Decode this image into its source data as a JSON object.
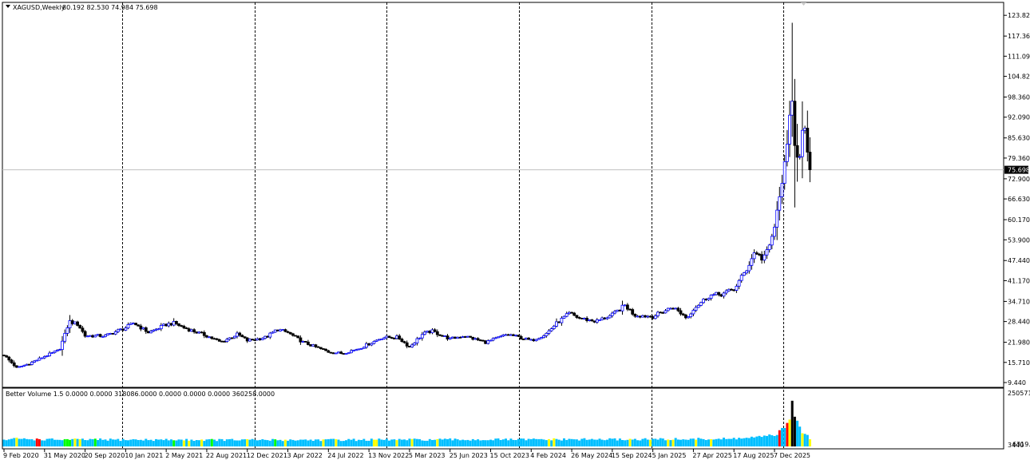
{
  "chart_data": {
    "type": "candlestick",
    "symbol_label": "XAGUSD,Weekly",
    "ohlc_label": "80.192 82.530 74.984 75.698",
    "last_price": 75.698,
    "last_price_label": "75.698",
    "ylim": [
      9.44,
      126.6
    ],
    "y_ticks": [
      "123.820",
      "117.360",
      "111.090",
      "104.820",
      "98.360",
      "92.090",
      "85.630",
      "79.360",
      "72.900",
      "66.630",
      "60.170",
      "53.900",
      "47.440",
      "41.170",
      "34.710",
      "28.440",
      "21.980",
      "15.710",
      "9.440"
    ],
    "x_ticks": [
      "9 Feb 2020",
      "31 May 2020",
      "20 Sep 2020",
      "10 Jan 2021",
      "2 May 2021",
      "22 Aug 2021",
      "12 Dec 2021",
      "3 Apr 2022",
      "24 Jul 2022",
      "13 Nov 2022",
      "5 Mar 2023",
      "25 Jun 2023",
      "15 Oct 2023",
      "4 Feb 2024",
      "26 May 2024",
      "15 Sep 2024",
      "5 Jan 2025",
      "27 Apr 2025",
      "17 Aug 2025",
      "7 Dec 2025"
    ],
    "period_separators": [
      "2021",
      "2022",
      "2023",
      "2024",
      "2025",
      "2026"
    ],
    "price_path": [
      [
        "2020-02-09",
        18.0
      ],
      [
        "2020-03-15",
        14.0
      ],
      [
        "2020-04-20",
        15.4
      ],
      [
        "2020-05-31",
        17.6
      ],
      [
        "2020-07-10",
        19.5
      ],
      [
        "2020-07-25",
        24.0
      ],
      [
        "2020-08-07",
        28.5
      ],
      [
        "2020-09-01",
        27.5
      ],
      [
        "2020-09-20",
        24.0
      ],
      [
        "2020-11-15",
        24.0
      ],
      [
        "2021-01-10",
        26.5
      ],
      [
        "2021-02-01",
        28.0
      ],
      [
        "2021-03-15",
        25.0
      ],
      [
        "2021-05-02",
        27.5
      ],
      [
        "2021-05-25",
        28.0
      ],
      [
        "2021-06-20",
        26.5
      ],
      [
        "2021-08-22",
        24.0
      ],
      [
        "2021-09-30",
        22.0
      ],
      [
        "2021-11-15",
        24.5
      ],
      [
        "2021-12-12",
        22.5
      ],
      [
        "2022-02-01",
        23.5
      ],
      [
        "2022-03-05",
        26.0
      ],
      [
        "2022-04-03",
        25.0
      ],
      [
        "2022-05-15",
        22.0
      ],
      [
        "2022-07-24",
        19.0
      ],
      [
        "2022-09-01",
        18.5
      ],
      [
        "2022-10-15",
        20.0
      ],
      [
        "2022-11-13",
        21.5
      ],
      [
        "2022-12-20",
        23.5
      ],
      [
        "2023-02-01",
        23.5
      ],
      [
        "2023-03-05",
        20.5
      ],
      [
        "2023-04-10",
        24.5
      ],
      [
        "2023-05-05",
        25.5
      ],
      [
        "2023-06-25",
        23.0
      ],
      [
        "2023-08-01",
        24.0
      ],
      [
        "2023-10-01",
        22.0
      ],
      [
        "2023-10-15",
        22.5
      ],
      [
        "2023-12-01",
        24.5
      ],
      [
        "2024-02-04",
        22.5
      ],
      [
        "2024-03-15",
        24.5
      ],
      [
        "2024-04-15",
        28.0
      ],
      [
        "2024-05-20",
        31.0
      ],
      [
        "2024-06-15",
        29.5
      ],
      [
        "2024-08-01",
        28.5
      ],
      [
        "2024-09-15",
        30.5
      ],
      [
        "2024-10-20",
        33.5
      ],
      [
        "2024-11-15",
        30.5
      ],
      [
        "2025-01-05",
        30.0
      ],
      [
        "2025-03-01",
        33.0
      ],
      [
        "2025-04-10",
        29.5
      ],
      [
        "2025-04-27",
        32.5
      ],
      [
        "2025-06-10",
        36.5
      ],
      [
        "2025-07-15",
        37.0
      ],
      [
        "2025-08-17",
        38.5
      ],
      [
        "2025-09-20",
        44.5
      ],
      [
        "2025-10-15",
        50.5
      ],
      [
        "2025-11-01",
        48.0
      ],
      [
        "2025-11-20",
        50.5
      ],
      [
        "2025-12-07",
        58.0
      ],
      [
        "2025-12-20",
        66.0
      ],
      [
        "2026-01-01",
        76.0
      ],
      [
        "2026-01-08",
        78.0
      ],
      [
        "2026-01-15",
        88.0
      ],
      [
        "2026-01-20",
        95.0
      ],
      [
        "2026-01-27",
        100.0
      ],
      [
        "2026-02-03",
        78.0
      ],
      [
        "2026-02-10",
        82.0
      ],
      [
        "2026-02-17",
        78.0
      ],
      [
        "2026-02-24",
        90.0
      ],
      [
        "2026-03-03",
        86.0
      ],
      [
        "2026-03-10",
        80.0
      ],
      [
        "2026-03-17",
        75.698
      ]
    ],
    "volatility_spikes": [
      {
        "date": "2026-01-27",
        "high": 121.5,
        "low": 86.0
      },
      {
        "date": "2026-02-03",
        "high": 104.0,
        "low": 64.0
      },
      {
        "date": "2026-02-10",
        "high": 90.0,
        "low": 72.0
      },
      {
        "date": "2026-02-24",
        "high": 97.0,
        "low": 80.0
      }
    ],
    "indicator": {
      "label": "Better Volume 1.5 0.0000 0.0000 318086.0000 0.0000 0.0000 0.0000 360258.0000",
      "ylim": [
        0,
        2505713
      ],
      "y_ticks": [
        "2505713.",
        "3440"
      ],
      "cut_tick_label": "6319.3",
      "volume_path": [
        [
          "2020-02-09",
          300000
        ],
        [
          "2020-03-15",
          360000
        ],
        [
          "2020-06-01",
          320000
        ],
        [
          "2022-01-01",
          300000
        ],
        [
          "2024-01-01",
          320000
        ],
        [
          "2025-01-01",
          330000
        ],
        [
          "2025-08-01",
          350000
        ],
        [
          "2025-11-15",
          450000
        ],
        [
          "2025-12-15",
          600000
        ],
        [
          "2026-01-10",
          900000
        ],
        [
          "2026-01-20",
          1200000
        ],
        [
          "2026-01-27",
          2450000
        ],
        [
          "2026-02-03",
          1350000
        ],
        [
          "2026-02-10",
          900000
        ],
        [
          "2026-02-17",
          750000
        ],
        [
          "2026-02-24",
          600000
        ],
        [
          "2026-03-10",
          500000
        ],
        [
          "2026-03-17",
          360000
        ]
      ],
      "highlight_bars": [
        {
          "date": "2020-05-10",
          "color": "#ff0000"
        },
        {
          "date": "2020-05-17",
          "color": "#ff0000"
        },
        {
          "date": "2025-12-21",
          "color": "#ff0000"
        },
        {
          "date": "2026-01-13",
          "color": "#ff0000"
        },
        {
          "date": "2026-01-27",
          "color": "#000000"
        },
        {
          "date": "2026-02-03",
          "color": "#000000"
        },
        {
          "date": "2026-03-17",
          "color": "#ffff00"
        }
      ]
    },
    "colors": {
      "background": "#ffffff",
      "bull_body": "#ffffff",
      "bull_outline": "#0000ff",
      "bear_body": "#000000",
      "wick": "#000000",
      "volume_default": "#00bfff",
      "volume_low": "#ffff00",
      "volume_climax": "#ff0000",
      "volume_churn": "#00ff00",
      "volume_high_churn": "#000000",
      "current_price_line": "#c0c0c0",
      "grid": "#000000"
    }
  }
}
